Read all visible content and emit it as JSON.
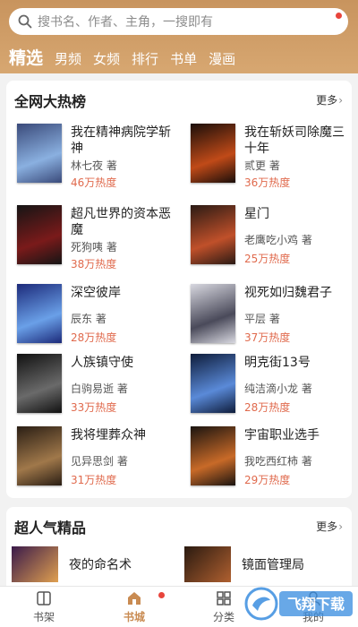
{
  "search": {
    "placeholder": "搜书名、作者、主角，一搜即有"
  },
  "tabs": [
    {
      "label": "精选"
    },
    {
      "label": "男频"
    },
    {
      "label": "女频"
    },
    {
      "label": "排行"
    },
    {
      "label": "书单"
    },
    {
      "label": "漫画"
    }
  ],
  "hot": {
    "title": "全网大热榜",
    "more": "更多",
    "books": [
      {
        "title": "我在精神病院学斩神",
        "author": "林七夜 著",
        "heat": "46万热度",
        "cover_colors": [
          "#3a4a7a",
          "#8ab0e0"
        ]
      },
      {
        "title": "我在斩妖司除魔三十年",
        "author": "贰更 著",
        "heat": "36万热度",
        "cover_colors": [
          "#1a0e0a",
          "#c04a18"
        ]
      },
      {
        "title": "超凡世界的资本恶魔",
        "author": "死狗咦 著",
        "heat": "38万热度",
        "cover_colors": [
          "#151515",
          "#7a1a1a"
        ]
      },
      {
        "title": "星门",
        "author": "老鹰吃小鸡 著",
        "heat": "25万热度",
        "cover_colors": [
          "#2a1a14",
          "#c0502a"
        ]
      },
      {
        "title": "深空彼岸",
        "author": "辰东 著",
        "heat": "28万热度",
        "cover_colors": [
          "#1c2a7a",
          "#6aa0e8"
        ]
      },
      {
        "title": "视死如归魏君子",
        "author": "平层 著",
        "heat": "37万热度",
        "cover_colors": [
          "#d8d8e0",
          "#4a4a5a"
        ]
      },
      {
        "title": "人族镇守使",
        "author": "白驹易逝 著",
        "heat": "33万热度",
        "cover_colors": [
          "#111111",
          "#6a6a6a"
        ]
      },
      {
        "title": "明克街13号",
        "author": "纯洁滴小龙 著",
        "heat": "28万热度",
        "cover_colors": [
          "#0e1c3a",
          "#5a8ad8"
        ]
      },
      {
        "title": "我将埋葬众神",
        "author": "见异思剑 著",
        "heat": "31万热度",
        "cover_colors": [
          "#2a1e14",
          "#a0784a"
        ]
      },
      {
        "title": "宇宙职业选手",
        "author": "我吃西红柿 著",
        "heat": "29万热度",
        "cover_colors": [
          "#1a1410",
          "#c86a28"
        ]
      }
    ]
  },
  "popular": {
    "title": "超人气精品",
    "more": "更多",
    "items": [
      {
        "title": "夜的命名术"
      },
      {
        "title": "镜面管理局"
      }
    ]
  },
  "nav": [
    {
      "label": "书架",
      "icon": "book-icon"
    },
    {
      "label": "书城",
      "icon": "store-icon"
    },
    {
      "label": "分类",
      "icon": "grid-icon"
    },
    {
      "label": "我的",
      "icon": "user-icon"
    }
  ],
  "watermark": "飞翔下载"
}
